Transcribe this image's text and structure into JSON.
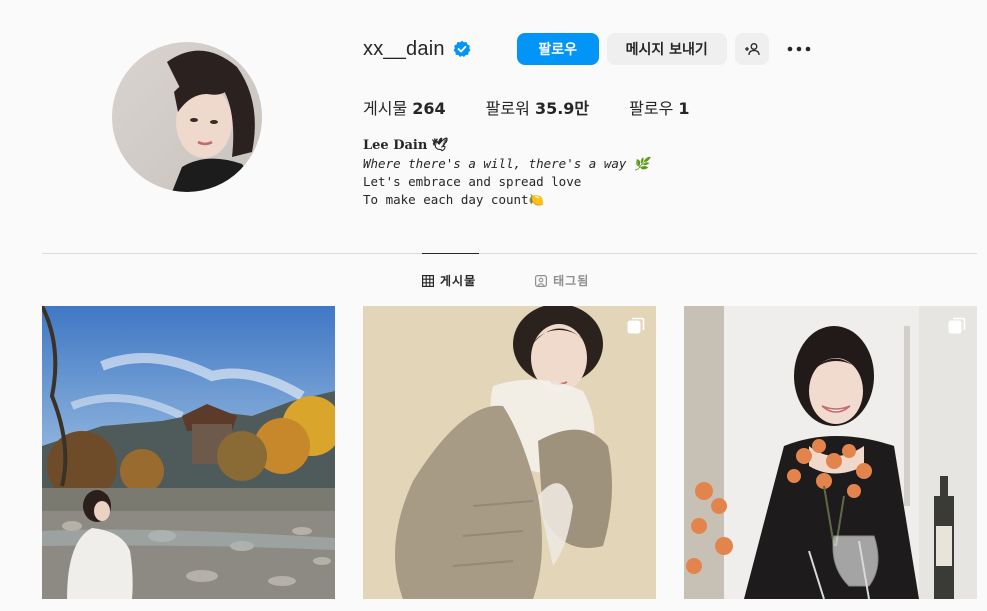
{
  "profile": {
    "username": "xx__dain",
    "verified": true,
    "avatar_icon": "profile-avatar"
  },
  "actions": {
    "follow_label": "팔로우",
    "message_label": "메시지 보내기",
    "suggest_icon": "person-add-icon",
    "more_icon": "more-options-icon"
  },
  "stats": {
    "posts_label": "게시물",
    "posts_count": "264",
    "followers_label": "팔로워",
    "followers_count": "35.9만",
    "following_label": "팔로우",
    "following_count": "1"
  },
  "bio": {
    "name": "Lee Dain 🕊",
    "line1": "Where there's a will, there's a way 🌿",
    "line2": "Let's embrace and spread love",
    "line3": "To make each day count🍋"
  },
  "tabs": [
    {
      "label": "게시물",
      "icon": "grid-icon",
      "active": true
    },
    {
      "label": "태그됨",
      "icon": "tagged-icon",
      "active": false
    }
  ],
  "posts": [
    {
      "type": "single"
    },
    {
      "type": "carousel",
      "icon": "carousel-icon"
    },
    {
      "type": "carousel",
      "icon": "carousel-icon"
    }
  ],
  "colors": {
    "primary_button": "#0095f6",
    "secondary_button": "#efefef",
    "verified_badge": "#0095f6",
    "background": "#fafafa"
  }
}
